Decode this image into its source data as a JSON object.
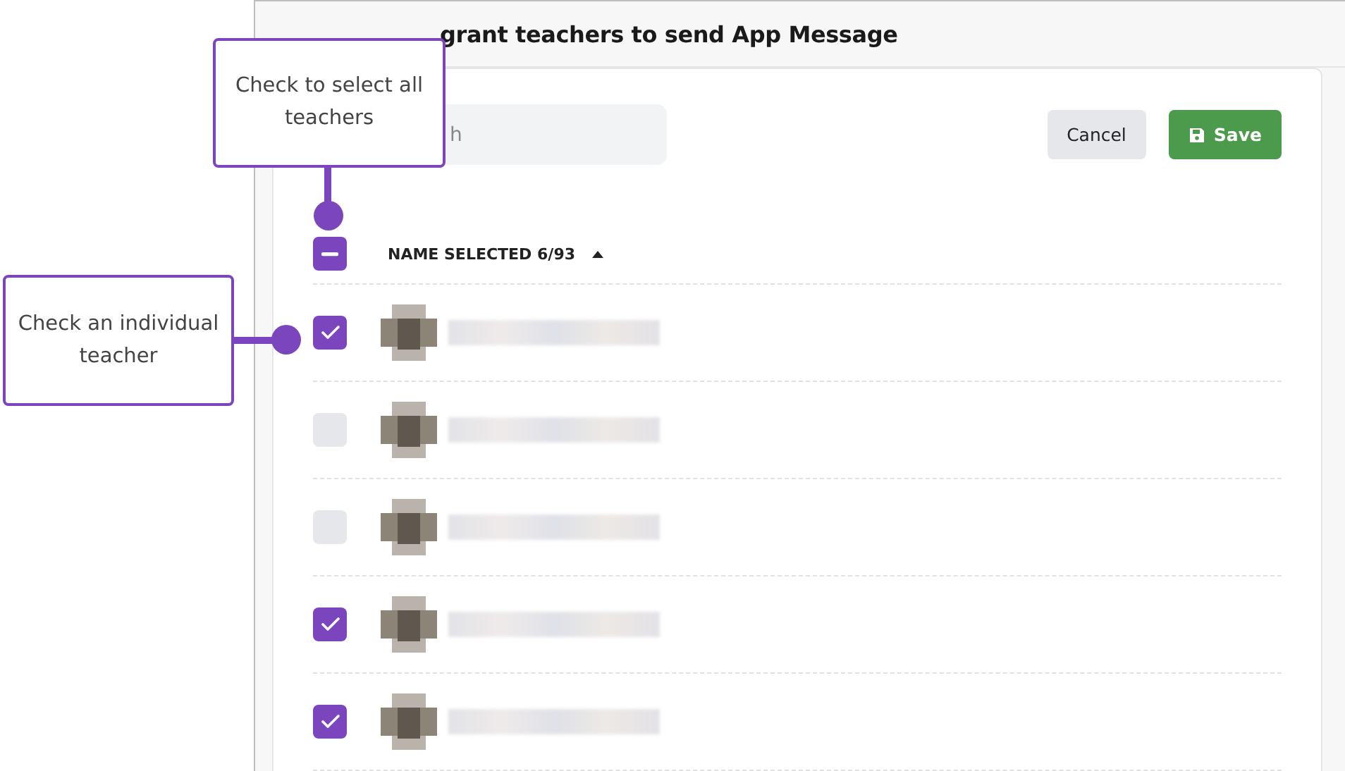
{
  "header": {
    "title": "grant teachers to send App Message"
  },
  "search": {
    "placeholder": "h"
  },
  "buttons": [
    {
      "label": "Cancel",
      "kind": "secondary"
    },
    {
      "label": "Save",
      "kind": "primary"
    }
  ],
  "table": {
    "select_all": {
      "checked": true,
      "indeterminate": true
    },
    "column": "NAME SELECTED 6/93",
    "sort_ascending": true,
    "rows": [
      {
        "checked": true
      },
      {
        "checked": false
      },
      {
        "checked": false
      },
      {
        "checked": true
      },
      {
        "checked": true
      }
    ]
  },
  "callouts": [
    {
      "text": "Check to select all teachers",
      "kind": "above"
    },
    {
      "text": "Check an individual teacher",
      "kind": "left"
    }
  ]
}
